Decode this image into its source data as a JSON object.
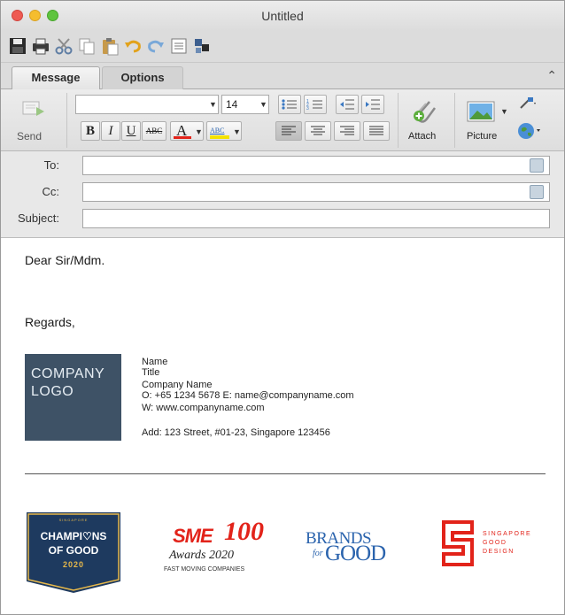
{
  "window": {
    "title": "Untitled"
  },
  "quick_toolbar": {
    "icons": [
      "save-icon",
      "print-icon",
      "cut-icon",
      "copy-icon",
      "paste-icon",
      "undo-icon",
      "redo-icon",
      "address-book-icon",
      "send-receive-icon"
    ]
  },
  "tabs": [
    {
      "label": "Message",
      "active": true
    },
    {
      "label": "Options",
      "active": false
    }
  ],
  "ribbon": {
    "send_label": "Send",
    "font_name": "",
    "font_size": "14",
    "bold": "B",
    "italic": "I",
    "underline": "U",
    "strikethrough": "ABC",
    "font_color_glyph": "A",
    "highlight_glyph": "ABC",
    "attach_label": "Attach",
    "picture_label": "Picture",
    "colors": {
      "font_color_bar": "#e2231a",
      "highlight_bar": "#f4e200"
    }
  },
  "header": {
    "to_label": "To:",
    "to_value": "",
    "cc_label": "Cc:",
    "cc_value": "",
    "subject_label": "Subject:",
    "subject_value": ""
  },
  "message": {
    "greeting": "Dear Sir/Mdm.",
    "closing": "Regards,",
    "logo_line1": "COMPANY",
    "logo_line2": "LOGO",
    "signature": {
      "name": "Name",
      "title": "Title",
      "company": "Company Name",
      "contact": "O: +65 1234 5678  E: name@companyname.com",
      "web": "W: www.companyname.com",
      "address": "Add: 123 Street, #01-23, Singapore 123456"
    },
    "badges": {
      "champions": {
        "top": "SINGAPORE",
        "line1": "CHAMPI♡NS",
        "line2": "OF GOOD",
        "year": "2020",
        "colors": {
          "bg": "#1e3a5f",
          "accent": "#e7b84a"
        }
      },
      "sme100": {
        "sme": "SME",
        "hundred": "100",
        "awards": "Awards 2020",
        "sub": "FAST MOVING COMPANIES",
        "colors": {
          "red": "#e2231a"
        }
      },
      "brands": {
        "line1": "BRANDS",
        "for": "for",
        "good": "GOOD",
        "colors": {
          "blue": "#2a63ad"
        }
      },
      "sgd": {
        "line1": "SINGAPORE",
        "line2": "GOOD",
        "line3": "DESIGN",
        "colors": {
          "red": "#e2231a"
        }
      }
    }
  }
}
